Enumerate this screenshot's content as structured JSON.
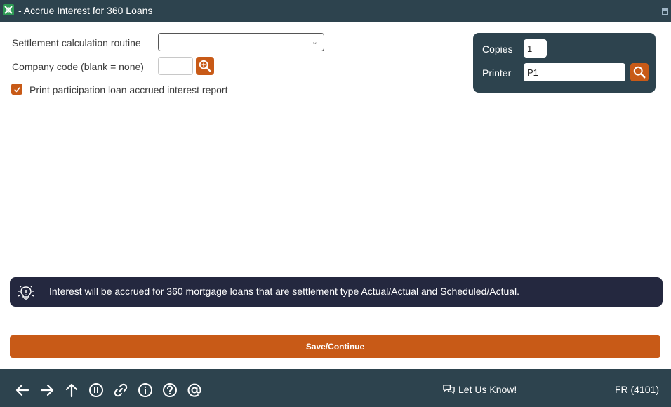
{
  "window": {
    "title": "- Accrue Interest for 360 Loans"
  },
  "form": {
    "settlement_label": "Settlement calculation routine",
    "settlement_value": "",
    "company_label": "Company code (blank = none)",
    "company_value": "",
    "participation_label": "Print participation loan accrued interest report",
    "participation_checked": true
  },
  "print": {
    "copies_label": "Copies",
    "copies_value": "1",
    "printer_label": "Printer",
    "printer_value": "P1"
  },
  "info": {
    "icon": "lightbulb-icon",
    "message": "Interest will be accrued for 360 mortgage loans that are settlement type Actual/Actual and Scheduled/Actual."
  },
  "actions": {
    "save_label": "Save/Continue"
  },
  "footer": {
    "feedback_label": "Let Us Know!",
    "screen_code": "FR (4101)",
    "icons": [
      "back-arrow-icon",
      "forward-arrow-icon",
      "up-arrow-icon",
      "pause-icon",
      "link-icon",
      "info-icon",
      "help-icon",
      "at-icon"
    ]
  },
  "colors": {
    "accent": "#c85a17",
    "header": "#2d434e",
    "info_bg": "#24283f"
  }
}
